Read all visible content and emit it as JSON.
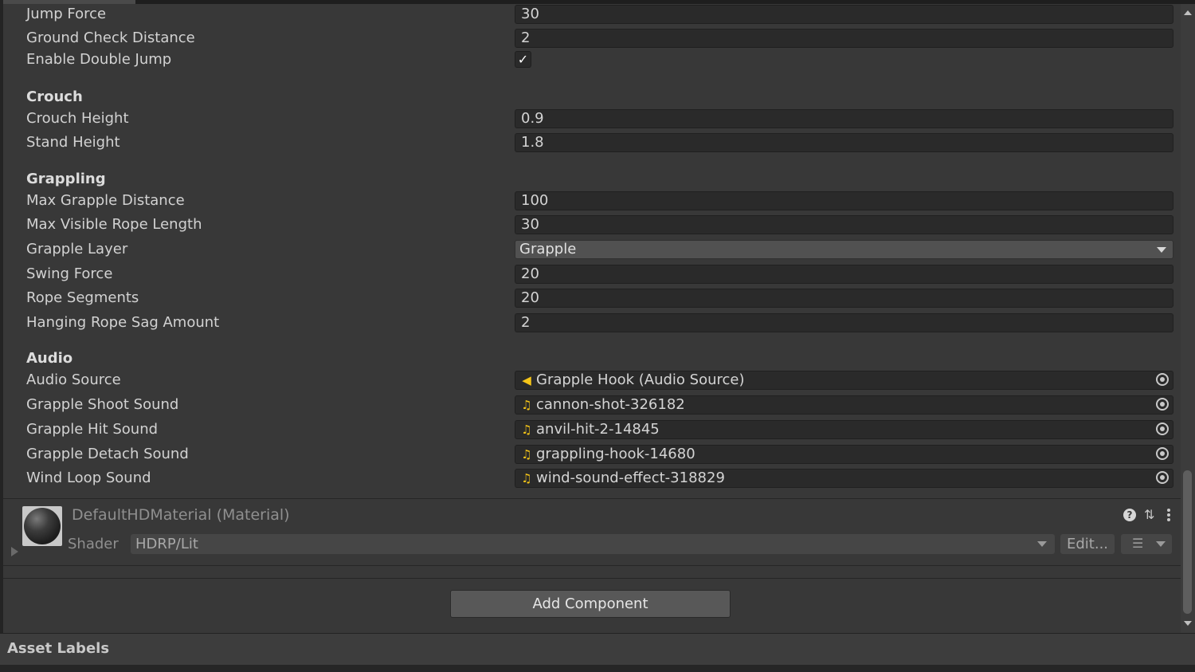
{
  "properties": {
    "jump_force": {
      "label": "Jump Force",
      "value": "30"
    },
    "ground_check_distance": {
      "label": "Ground Check Distance",
      "value": "2"
    },
    "enable_double_jump": {
      "label": "Enable Double Jump",
      "checked": true,
      "check_glyph": "✓"
    }
  },
  "crouch": {
    "header": "Crouch",
    "crouch_height": {
      "label": "Crouch Height",
      "value": "0.9"
    },
    "stand_height": {
      "label": "Stand Height",
      "value": "1.8"
    }
  },
  "grappling": {
    "header": "Grappling",
    "max_grapple_distance": {
      "label": "Max Grapple Distance",
      "value": "100"
    },
    "max_visible_rope_length": {
      "label": "Max Visible Rope Length",
      "value": "30"
    },
    "grapple_layer": {
      "label": "Grapple Layer",
      "value": "Grapple"
    },
    "swing_force": {
      "label": "Swing Force",
      "value": "20"
    },
    "rope_segments": {
      "label": "Rope Segments",
      "value": "20"
    },
    "hanging_rope_sag_amount": {
      "label": "Hanging Rope Sag Amount",
      "value": "2"
    }
  },
  "audio": {
    "header": "Audio",
    "audio_source": {
      "label": "Audio Source",
      "value": "Grapple Hook (Audio Source)",
      "icon": "speaker-icon",
      "glyph": "◀"
    },
    "grapple_shoot_sound": {
      "label": "Grapple Shoot Sound",
      "value": "cannon-shot-326182",
      "icon": "audio-clip-icon",
      "glyph": "♫"
    },
    "grapple_hit_sound": {
      "label": "Grapple Hit Sound",
      "value": "anvil-hit-2-14845",
      "icon": "audio-clip-icon",
      "glyph": "♫"
    },
    "grapple_detach_sound": {
      "label": "Grapple Detach Sound",
      "value": "grappling-hook-14680",
      "icon": "audio-clip-icon",
      "glyph": "♫"
    },
    "wind_loop_sound": {
      "label": "Wind Loop Sound",
      "value": "wind-sound-effect-318829",
      "icon": "audio-clip-icon",
      "glyph": "♫"
    }
  },
  "material": {
    "title": "DefaultHDMaterial (Material)",
    "shader_label": "Shader",
    "shader_value": "HDRP/Lit",
    "edit_label": "Edit...",
    "help_glyph": "?",
    "preset_glyph": "⇅",
    "list_glyph": "☰"
  },
  "add_component_label": "Add Component",
  "asset_labels_title": "Asset Labels",
  "colors": {
    "background": "#383838",
    "field": "#2a2a2a",
    "object_icon": "#f5c518",
    "text": "#d2d2d2"
  }
}
